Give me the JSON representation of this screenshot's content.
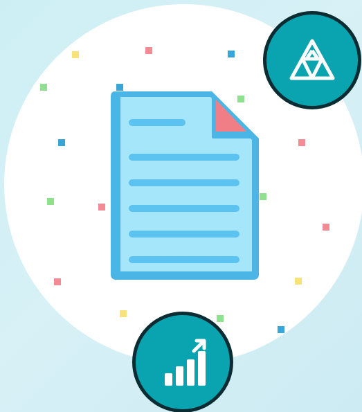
{
  "colors": {
    "background": "#d4eff5",
    "circle": "#ffffff",
    "badge_fill": "#0aa4b1",
    "badge_ring": "#0c2c33",
    "doc_outline": "#4bb6e6",
    "doc_paper": "#a6e6fb",
    "doc_lines": "#5cc2f0",
    "doc_corner": "#f07e86",
    "confetti_pink": "#f28b93",
    "confetti_green": "#8fe08f",
    "confetti_blue": "#3aa6d8",
    "confetti_yellow": "#f7e37a"
  },
  "illustration": {
    "main": "document-icon",
    "badges": [
      "triangle-icon",
      "growth-chart-icon"
    ]
  }
}
